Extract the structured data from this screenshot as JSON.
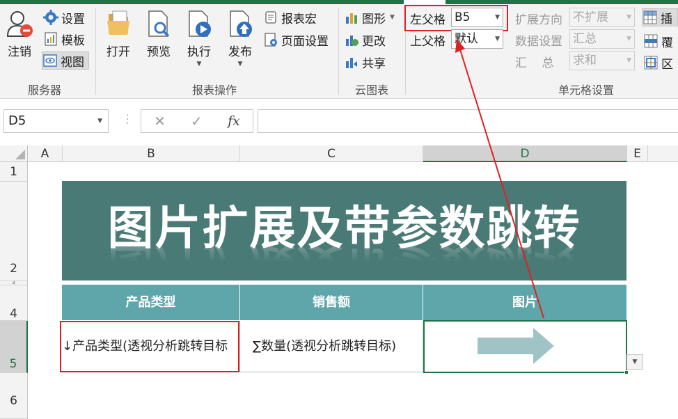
{
  "ribbon": {
    "server": {
      "group_label": "服务器",
      "logout_label": "注销",
      "settings_label": "设置",
      "template_label": "模板",
      "view_label": "视图"
    },
    "report_ops": {
      "group_label": "报表操作",
      "open_label": "打开",
      "preview_label": "预览",
      "execute_label": "执行",
      "publish_label": "发布",
      "macro_label": "报表宏",
      "page_setup_label": "页面设置"
    },
    "cloud_chart": {
      "group_label": "云图表",
      "chart_label": "图形",
      "change_label": "更改",
      "share_label": "共享"
    },
    "cell_settings": {
      "group_label": "单元格设置",
      "left_parent_label": "左父格",
      "left_parent_value": "B5",
      "top_parent_label": "上父格",
      "top_parent_value": "默认",
      "expand_dir_label": "扩展方向",
      "expand_dir_value": "不扩展",
      "data_setting_label": "数据设置",
      "data_setting_value": "汇总",
      "summary_label": "汇    总",
      "summary_value": "求和",
      "insert_label": "插",
      "cover_label": "覆",
      "region_label": "区"
    }
  },
  "formula_bar": {
    "name_box": "D5",
    "formula": ""
  },
  "grid": {
    "columns": [
      "A",
      "B",
      "C",
      "D",
      "E"
    ],
    "rows": [
      "1",
      "2",
      "3",
      "4",
      "5",
      "6"
    ],
    "banner_title": "图片扩展及带参数跳转",
    "headers": [
      "产品类型",
      "销售额",
      "图片"
    ],
    "row5": {
      "b": "↓产品类型(透视分析跳转目标",
      "c": "∑数量(透视分析跳转目标)"
    }
  },
  "colors": {
    "accent": "#217346",
    "banner_bg": "#4a7a76",
    "header_bg": "#5fa6ab",
    "annotation_red": "#e02020"
  }
}
